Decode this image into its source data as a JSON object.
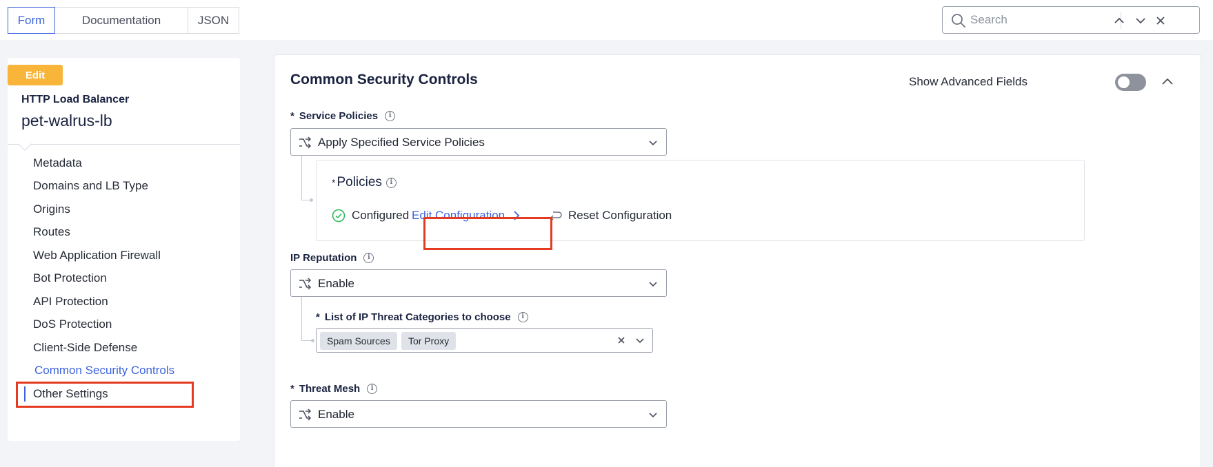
{
  "toolbar": {
    "tabs": [
      {
        "label": "Form",
        "active": true
      },
      {
        "label": "Documentation",
        "active": false
      },
      {
        "label": "JSON",
        "active": false
      }
    ],
    "search": {
      "placeholder": "Search",
      "value": ""
    }
  },
  "sidebar": {
    "badge": "Edit",
    "object_type": "HTTP Load Balancer",
    "object_name": "pet-walrus-lb",
    "items": [
      {
        "label": "Metadata"
      },
      {
        "label": "Domains and LB Type"
      },
      {
        "label": "Origins"
      },
      {
        "label": "Routes"
      },
      {
        "label": "Web Application Firewall"
      },
      {
        "label": "Bot Protection"
      },
      {
        "label": "API Protection"
      },
      {
        "label": "DoS Protection"
      },
      {
        "label": "Client-Side Defense"
      },
      {
        "label": "Common Security Controls"
      },
      {
        "label": "Other Settings"
      }
    ],
    "active_item": "Common Security Controls"
  },
  "main": {
    "section_title": "Common Security Controls",
    "show_advanced_label": "Show Advanced Fields",
    "show_advanced_enabled": false,
    "service_policies": {
      "label": "Service Policies",
      "required_mark": "*",
      "value": "Apply Specified Service Policies",
      "policies": {
        "title": "Policies",
        "required_mark": "*",
        "status": "Configured",
        "edit_link": "Edit Configuration",
        "reset_link": "Reset Configuration"
      }
    },
    "ip_reputation": {
      "label": "IP Reputation",
      "value": "Enable",
      "threat_categories": {
        "label": "List of IP Threat Categories to choose",
        "required_mark": "*",
        "chips": [
          "Spam Sources",
          "Tor Proxy"
        ]
      }
    },
    "threat_mesh": {
      "label": "Threat Mesh",
      "required_mark": "*",
      "value": "Enable"
    }
  },
  "colors": {
    "accent": "#3d63dd",
    "highlight": "#e53a22",
    "badge": "#f8b53a",
    "success": "#2eb85c"
  }
}
